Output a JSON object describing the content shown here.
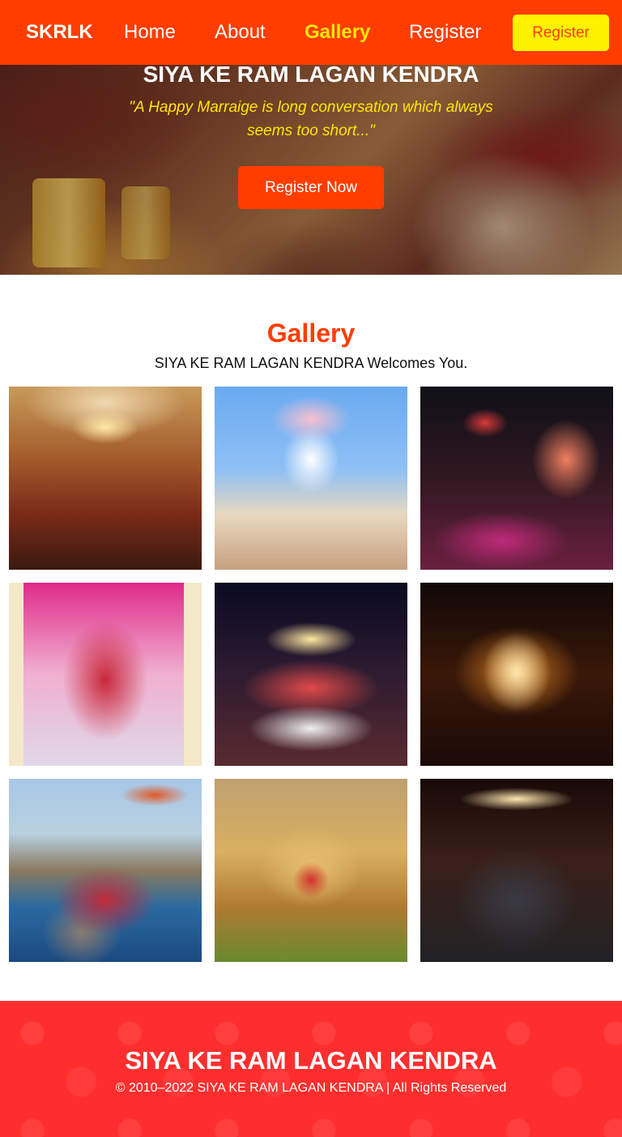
{
  "navbar": {
    "brand": "SKRLK",
    "links": [
      "Home",
      "About",
      "Gallery",
      "Register"
    ],
    "active": "Gallery",
    "cta_label": "Register",
    "colors": {
      "background": "#ff3d00",
      "active_link": "#ffe600",
      "cta_background": "#fff200"
    }
  },
  "hero": {
    "title": "SIYA KE RAM LAGAN KENDRA",
    "quote": "\"A Happy Marraige is long conversation which always seems too short...\"",
    "button_label": "Register Now"
  },
  "gallery": {
    "title": "Gallery",
    "subtitle": "SIYA KE RAM LAGAN KENDRA Welcomes You.",
    "photos": [
      "wedding-hall-chandelier",
      "white-floral-mandap",
      "night-mandap-umbrella",
      "bride-red-veil",
      "baraat-white-horses",
      "illuminated-fountain",
      "couple-on-elephant",
      "golden-stage-decor",
      "dancing-crowd"
    ]
  },
  "footer": {
    "title": "SIYA KE RAM LAGAN KENDRA",
    "copyright": "© 2010–2022 SIYA KE RAM LAGAN KENDRA | All Rights Reserved",
    "background_color": "#ff2e2e"
  }
}
